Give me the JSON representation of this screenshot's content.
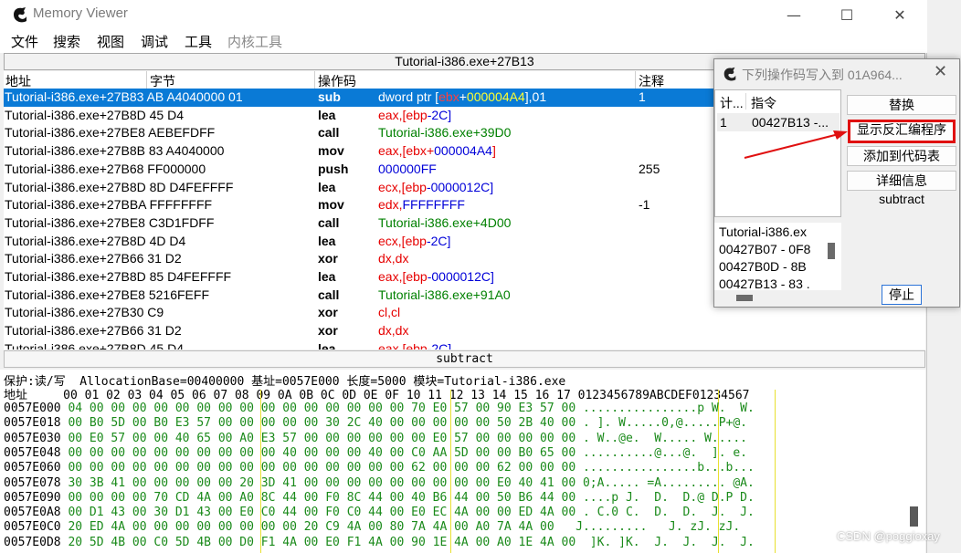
{
  "window": {
    "title": "Memory Viewer",
    "controls": [
      "—",
      "☐",
      "✕"
    ]
  },
  "menu": [
    "文件",
    "搜索",
    "视图",
    "调试",
    "工具",
    "内核工具"
  ],
  "disasm": {
    "header": "Tutorial-i386.exe+27B13",
    "columns": [
      "地址",
      "字节",
      "操作码",
      "注释"
    ],
    "rows": [
      {
        "addr": "Tutorial-i386.exe+27B8",
        "bytes": "3 AB A4040000 01",
        "op": "sub",
        "args": [
          [
            "dword ptr [",
            ""
          ],
          [
            "ebx",
            "red"
          ],
          [
            "+",
            ""
          ],
          [
            "000004A4",
            "green"
          ],
          [
            "],01",
            ""
          ]
        ],
        "cmt": "1"
      },
      {
        "addr": "Tutorial-i386.exe+27B8",
        "bytes": "D 45 D4",
        "op": "lea",
        "args": [
          [
            "eax",
            "red"
          ],
          [
            ",[",
            "red"
          ],
          [
            "ebp",
            "red"
          ],
          [
            "-2C]",
            "blue"
          ]
        ],
        "cmt": ""
      },
      {
        "addr": "Tutorial-i386.exe+27B",
        "bytes": "E8 AEBEFDFF",
        "op": "call",
        "args": [
          [
            "Tutorial-i386.exe+39D0",
            "green"
          ]
        ],
        "cmt": ""
      },
      {
        "addr": "Tutorial-i386.exe+27B8",
        "bytes": "B 83 A4040000",
        "op": "mov",
        "args": [
          [
            "eax",
            "red"
          ],
          [
            ",[",
            "red"
          ],
          [
            "ebx",
            "red"
          ],
          [
            "+",
            "red"
          ],
          [
            "000004A4",
            "blue"
          ],
          [
            "]",
            "red"
          ]
        ],
        "cmt": ""
      },
      {
        "addr": "Tutorial-i386.exe+27B6",
        "bytes": "8 FF000000",
        "op": "push",
        "args": [
          [
            "000000FF",
            "blue"
          ]
        ],
        "cmt": "255"
      },
      {
        "addr": "Tutorial-i386.exe+27B8",
        "bytes": "D 8D D4FEFFFF",
        "op": "lea",
        "args": [
          [
            "ecx",
            "red"
          ],
          [
            ",[",
            "red"
          ],
          [
            "ebp",
            "red"
          ],
          [
            "-0000012C]",
            "blue"
          ]
        ],
        "cmt": ""
      },
      {
        "addr": "Tutorial-i386.exe+27B",
        "bytes": "BA FFFFFFFF",
        "op": "mov",
        "args": [
          [
            "edx",
            "red"
          ],
          [
            ",",
            "red"
          ],
          [
            "FFFFFFFF",
            "blue"
          ]
        ],
        "cmt": "-1"
      },
      {
        "addr": "Tutorial-i386.exe+27B",
        "bytes": "E8 C3D1FDFF",
        "op": "call",
        "args": [
          [
            "Tutorial-i386.exe+4D00",
            "green"
          ]
        ],
        "cmt": ""
      },
      {
        "addr": "Tutorial-i386.exe+27B8",
        "bytes": "D 4D D4",
        "op": "lea",
        "args": [
          [
            "ecx",
            "red"
          ],
          [
            ",[",
            "red"
          ],
          [
            "ebp",
            "red"
          ],
          [
            "-2C]",
            "blue"
          ]
        ],
        "cmt": ""
      },
      {
        "addr": "Tutorial-i386.exe+27B6",
        "bytes": "6 31 D2",
        "op": "xor",
        "args": [
          [
            "dx,dx",
            "red"
          ]
        ],
        "cmt": ""
      },
      {
        "addr": "Tutorial-i386.exe+27B8",
        "bytes": "D 85 D4FEFFFF",
        "op": "lea",
        "args": [
          [
            "eax",
            "red"
          ],
          [
            ",[",
            "red"
          ],
          [
            "ebp",
            "red"
          ],
          [
            "-0000012C]",
            "blue"
          ]
        ],
        "cmt": ""
      },
      {
        "addr": "Tutorial-i386.exe+27B",
        "bytes": "E8 5216FEFF",
        "op": "call",
        "args": [
          [
            "Tutorial-i386.exe+91A0",
            "green"
          ]
        ],
        "cmt": ""
      },
      {
        "addr": "Tutorial-i386.exe+27B3",
        "bytes": "0 C9",
        "op": "xor",
        "args": [
          [
            "cl,cl",
            "red"
          ]
        ],
        "cmt": ""
      },
      {
        "addr": "Tutorial-i386.exe+27B6",
        "bytes": "6 31 D2",
        "op": "xor",
        "args": [
          [
            "dx,dx",
            "red"
          ]
        ],
        "cmt": ""
      },
      {
        "addr": "Tutorial-i386.exe+27B8",
        "bytes": "D 45 D4",
        "op": "lea",
        "args": [
          [
            "eax",
            "red"
          ],
          [
            ",[",
            "red"
          ],
          [
            "ebp",
            "red"
          ],
          [
            "-2C]",
            "blue"
          ]
        ],
        "cmt": ""
      }
    ],
    "status": "subtract"
  },
  "hex": {
    "info": "保护:读/写  AllocationBase=00400000 基址=0057E000 长度=5000 模块=Tutorial-i386.exe",
    "header": "地址     00 01 02 03 04 05 06 07 08 09 0A 0B 0C 0D 0E 0F 10 11 12 13 14 15 16 17 0123456789ABCDEF01234567",
    "rows": [
      {
        "addr": "0057E000",
        "bytes": "04 00 00 00 00 00 00 00 00 00 00 00 00 00 00 00 70 E0 57 00 90 E3 57 00",
        "ascii": "................p W.  W."
      },
      {
        "addr": "0057E018",
        "bytes": "00 B0 5D 00 B0 E3 57 00 00 00 00 00 30 2C 40 00 00 00 00 00 50 2B 40 00",
        "ascii": ". ]. W.....0,@.....P+@."
      },
      {
        "addr": "0057E030",
        "bytes": "00 E0 57 00 00 40 65 00 A0 E3 57 00 00 00 00 00 00 E0 57 00 00 00 00 00",
        "ascii": ". W..@e.  W..... W....."
      },
      {
        "addr": "0057E048",
        "bytes": "00 00 00 00 00 00 00 00 00 00 40 00 00 00 40 00 C0 AA 5D 00 00 B0 65 00",
        "ascii": "..........@...@.  ]. e."
      },
      {
        "addr": "0057E060",
        "bytes": "00 00 00 00 00 00 00 00 00 00 00 00 00 00 00 00 62 00 00 00 62 00 00 00",
        "ascii": "................b...b..."
      },
      {
        "addr": "0057E078",
        "bytes": "30 3B 41 00 00 00 00 00 20 3D 41 00 00 00 00 00 00 00 00 00 E0 40 41 00",
        "ascii": "0;A..... =A......... @A."
      },
      {
        "addr": "0057E090",
        "bytes": "00 00 00 00 70 CD 4A 00 A0 8C 44 00 F0 8C 44 00 40 B6 44 00 50 B6 44 00",
        "ascii": "....p J.  D.  D.@ D.P D."
      },
      {
        "addr": "0057E0A8",
        "bytes": "00 D1 43 00 30 D1 43 00 E0 C0 44 00 F0 C0 44 00 E0 EC 4A 00 00 ED 4A 00",
        "ascii": ". C.0 C.  D.  D.  J.  J."
      },
      {
        "addr": "0057E0C0",
        "bytes": "20 ED 4A 00 00 00 00 00 00 00 00 20 C9 4A 00 80 7A 4A 00 A0 7A 4A 00",
        "ascii": "  J.........   J. zJ. zJ."
      },
      {
        "addr": "0057E0D8",
        "bytes": "20 5D 4B 00 C0 5D 4B 00 D0 F1 4A 00 E0 F1 4A 00 90 1E 4A 00 A0 1E 4A 00",
        "ascii": " ]K. ]K.  J.  J.  J.  J."
      }
    ]
  },
  "dialog": {
    "title": "下列操作码写入到 01A964...",
    "list_headers": [
      "计...",
      "指令"
    ],
    "list_row": [
      "1",
      "00427B13 -..."
    ],
    "info_lines": [
      "Tutorial-i386.ex",
      "00427B07 - 0F8",
      "00427B0D - 8B",
      "00427B13 - 83 ."
    ],
    "buttons": [
      "替换",
      "显示反汇编程序",
      "添加到代码表",
      "详细信息"
    ],
    "op_label": "subtract",
    "stop": "停止"
  },
  "watermark": "CSDN @poggioxay",
  "colors": {
    "selection": "#0a7ad6",
    "highlight_box": "#e01010",
    "arrow": "#e01010",
    "hex_green": "#1a8a1a"
  }
}
